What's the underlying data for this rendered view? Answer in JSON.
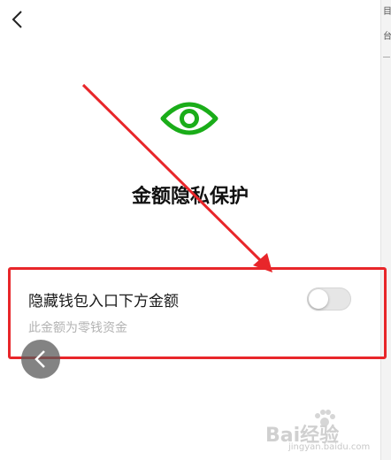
{
  "header": {
    "back_icon": "chevron-left-icon"
  },
  "hero": {
    "icon": "eye-icon",
    "icon_color": "#1aad19",
    "title": "金额隐私保护"
  },
  "setting": {
    "label": "隐藏钱包入口下方金额",
    "description": "此金额为零钱资金",
    "toggle_on": false
  },
  "annotation": {
    "color": "#e8262a"
  },
  "overlay": {
    "floating_back_icon": "chevron-left-icon"
  },
  "watermark": {
    "logo_text": "Bai经验",
    "url": "jingyan.baidu.com"
  },
  "side_panel": {
    "glyphs": [
      "目",
      "台"
    ]
  }
}
